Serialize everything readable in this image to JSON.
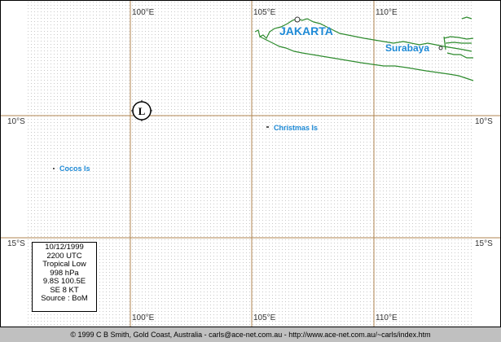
{
  "map": {
    "longitude_labels": [
      "100°E",
      "105°E",
      "110°E"
    ],
    "latitude_labels": [
      "10°S",
      "15°S"
    ],
    "places": [
      {
        "name": "JAKARTA"
      },
      {
        "name": "Surabaya"
      },
      {
        "name": "Christmas Is"
      },
      {
        "name": "Cocos Is"
      }
    ],
    "storm_symbol": "L",
    "colors": {
      "grid": "#b08650",
      "dots": "#c8c8c8",
      "coastline": "#2e8b2e",
      "labels": "#1e8ad6",
      "background": "#c0c0c0"
    }
  },
  "info": {
    "date": "10/12/1999",
    "time": "2200 UTC",
    "category": "Tropical Low",
    "pressure": "998 hPa",
    "position": "9.8S 100.5E",
    "movement": "SE 8 KT",
    "source": "Source : BoM"
  },
  "footer": {
    "text": "© 1999 C B Smith, Gold Coast, Australia - carls@ace-net.com.au - http://www.ace-net.com.au/~carls/index.htm"
  }
}
